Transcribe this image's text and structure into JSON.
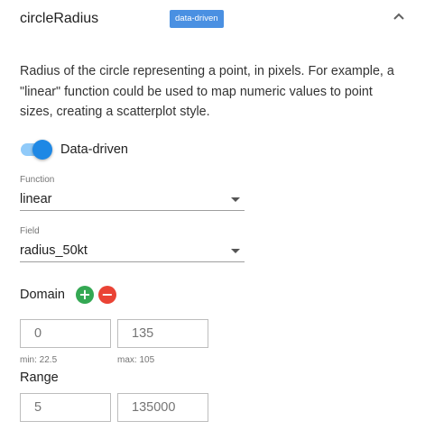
{
  "header": {
    "title": "circleRadius",
    "badge": "data-driven"
  },
  "description": "Radius of the circle representing a point, in pixels. For example, a \"linear\" function could be used to map numeric values to point sizes, creating a scatterplot style.",
  "toggle": {
    "label": "Data-driven",
    "checked": true
  },
  "function": {
    "label": "Function",
    "value": "linear"
  },
  "field": {
    "label": "Field",
    "value": "radius_50kt"
  },
  "domain": {
    "label": "Domain",
    "add_symbol": "+",
    "remove_symbol": "−",
    "min_value": "0",
    "max_value": "135",
    "min_hint": "min: 22.5",
    "max_hint": "max: 105"
  },
  "range": {
    "label": "Range",
    "min_value": "5",
    "max_value": "135000"
  },
  "colors": {
    "badge": "#4a90e2",
    "toggle": "#1e88e5",
    "add": "#34a853",
    "remove": "#ea4335"
  }
}
